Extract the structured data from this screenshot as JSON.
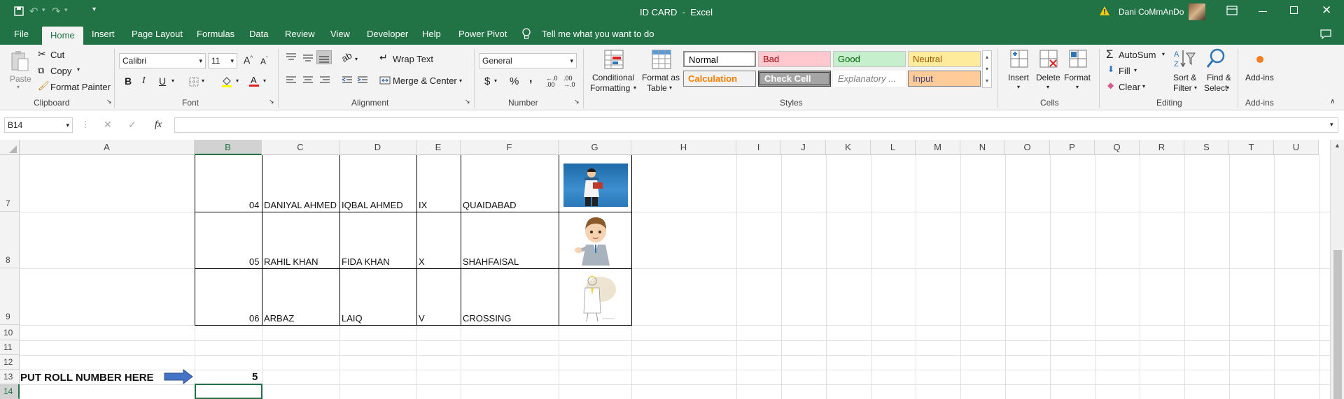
{
  "titlebar": {
    "doc_title": "ID CARD  -  Excel",
    "user_name": "Dani CoMmAnDo"
  },
  "tabs": [
    "File",
    "Home",
    "Insert",
    "Page Layout",
    "Formulas",
    "Data",
    "Review",
    "View",
    "Developer",
    "Help",
    "Power Pivot"
  ],
  "tell_me": "Tell me what you want to do",
  "ribbon": {
    "clipboard": {
      "paste": "Paste",
      "cut": "Cut",
      "copy": "Copy",
      "format_painter": "Format Painter",
      "label": "Clipboard"
    },
    "font": {
      "name": "Calibri",
      "size": "11",
      "label": "Font",
      "bold": "B",
      "italic": "I",
      "underline": "U"
    },
    "alignment": {
      "wrap": "Wrap Text",
      "merge": "Merge & Center",
      "label": "Alignment"
    },
    "number": {
      "format": "General",
      "currency": "$",
      "percent": "%",
      "comma": ",",
      "label": "Number"
    },
    "styles": {
      "conditional_1": "Conditional",
      "conditional_2": "Formatting",
      "format_table_1": "Format as",
      "format_table_2": "Table",
      "normal": "Normal",
      "bad": "Bad",
      "good": "Good",
      "neutral": "Neutral",
      "calculation": "Calculation",
      "check_cell": "Check Cell",
      "explanatory": "Explanatory ...",
      "input": "Input",
      "label": "Styles"
    },
    "cells": {
      "insert": "Insert",
      "delete": "Delete",
      "format": "Format",
      "label": "Cells"
    },
    "editing": {
      "autosum": "AutoSum",
      "fill": "Fill",
      "clear": "Clear",
      "sort_1": "Sort &",
      "sort_2": "Filter",
      "find_1": "Find &",
      "find_2": "Select",
      "label": "Editing"
    },
    "addins": {
      "button": "Add-ins",
      "label": "Add-ins"
    }
  },
  "formula_bar": {
    "name_box": "B14",
    "fx": "fx",
    "value": ""
  },
  "columns": [
    "A",
    "B",
    "C",
    "D",
    "E",
    "F",
    "G",
    "H",
    "I",
    "J",
    "K",
    "L",
    "M",
    "N",
    "O",
    "P",
    "Q",
    "R",
    "S",
    "T",
    "U"
  ],
  "rows": [
    "7",
    "8",
    "9",
    "10",
    "11",
    "12",
    "13",
    "14"
  ],
  "records": [
    {
      "roll": "04",
      "name": "DANIYAL AHMED",
      "father": "IQBAL AHMED",
      "class": "IX",
      "address": "QUAIDABAD"
    },
    {
      "roll": "05",
      "name": "RAHIL KHAN",
      "father": "FIDA KHAN",
      "class": "X",
      "address": "SHAHFAISAL"
    },
    {
      "roll": "06",
      "name": "ARBAZ",
      "father": "LAIQ",
      "class": "V",
      "address": "CROSSING"
    }
  ],
  "prompt": {
    "label": "PUT ROLL NUMBER HERE",
    "value": "5"
  },
  "colors": {
    "excel_green": "#217346",
    "ribbon_bg": "#f3f3f3",
    "selection": "#217346"
  }
}
